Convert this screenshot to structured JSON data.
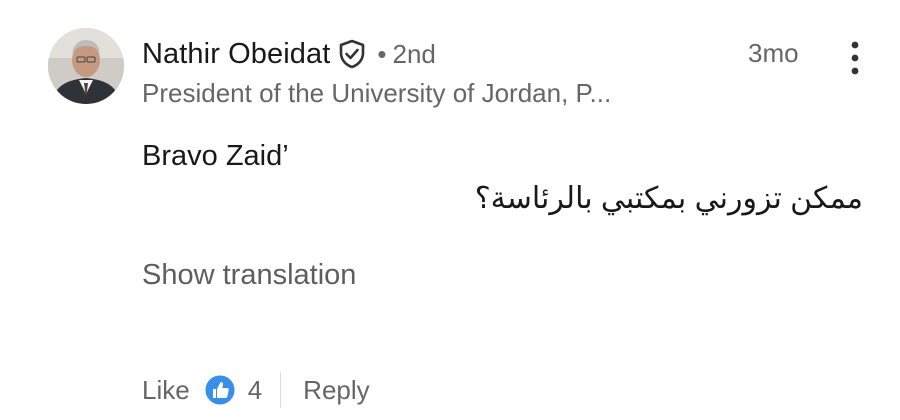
{
  "author": {
    "name": "Nathir Obeidat",
    "verified_icon": "verified-shield-icon",
    "separator": "•",
    "connection_degree": "2nd",
    "headline": "President of the University of Jordan, P..."
  },
  "timestamp": "3mo",
  "more_icon": "more-vertical-icon",
  "comment": {
    "text_en": "Bravo Zaid’",
    "text_ar": "ممكن تزورني بمكتبي بالرئاسة؟"
  },
  "show_translation_label": "Show translation",
  "actions": {
    "like_label": "Like",
    "like_icon": "like-reaction-icon",
    "like_count": "4",
    "reply_label": "Reply"
  },
  "colors": {
    "text_primary": "#191919",
    "text_secondary": "#666666",
    "like_blue": "#378fe9"
  }
}
